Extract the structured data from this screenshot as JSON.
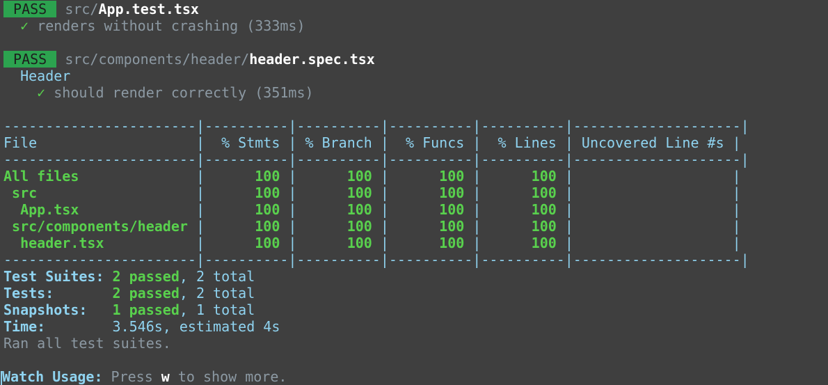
{
  "suite1": {
    "badge": "PASS",
    "path_prefix": "src/",
    "file": "App.test.tsx",
    "check": "✓",
    "test": "renders without crashing (333ms)"
  },
  "suite2": {
    "badge": "PASS",
    "path_prefix": "src/components/header/",
    "file": "header.spec.tsx",
    "describe": "Header",
    "check": "✓",
    "test": "should render correctly (351ms)"
  },
  "coverage": {
    "border_top": "-----------------------|----------|----------|----------|----------|--------------------|",
    "header": {
      "file": "File                   ",
      "sep": "|",
      "stmts": "  % Stmts ",
      "branch": " % Branch ",
      "funcs": "  % Funcs ",
      "lines": "  % Lines ",
      "uncovered": " Uncovered Line #s "
    },
    "border_mid": "-----------------------|----------|----------|----------|----------|--------------------|",
    "rows": [
      {
        "name": "All files              ",
        "stmts": "      100 ",
        "branch": "      100 ",
        "funcs": "      100 ",
        "lines": "      100 ",
        "uncovered": "                   "
      },
      {
        "name": " src                   ",
        "stmts": "      100 ",
        "branch": "      100 ",
        "funcs": "      100 ",
        "lines": "      100 ",
        "uncovered": "                   "
      },
      {
        "name": "  App.tsx              ",
        "stmts": "      100 ",
        "branch": "      100 ",
        "funcs": "      100 ",
        "lines": "      100 ",
        "uncovered": "                   "
      },
      {
        "name": " src/components/header ",
        "stmts": "      100 ",
        "branch": "      100 ",
        "funcs": "      100 ",
        "lines": "      100 ",
        "uncovered": "                   "
      },
      {
        "name": "  header.tsx           ",
        "stmts": "      100 ",
        "branch": "      100 ",
        "funcs": "      100 ",
        "lines": "      100 ",
        "uncovered": "                   "
      }
    ],
    "border_bottom": "-----------------------|----------|----------|----------|----------|--------------------|"
  },
  "summary": {
    "suites_label": "Test Suites:",
    "suites_passed": "2 passed",
    "suites_total": ", 2 total",
    "tests_label": "Tests:",
    "tests_passed": "2 passed",
    "tests_total": ", 2 total",
    "snapshots_label": "Snapshots:",
    "snapshots_passed": "1 passed",
    "snapshots_total": ", 1 total",
    "time_label": "Time:",
    "time_value": "3.546s, estimated 4s",
    "ran": "Ran all test suites."
  },
  "watch": {
    "label": "Watch Usage:",
    "press": " Press ",
    "key": "w",
    "rest": " to show more."
  }
}
